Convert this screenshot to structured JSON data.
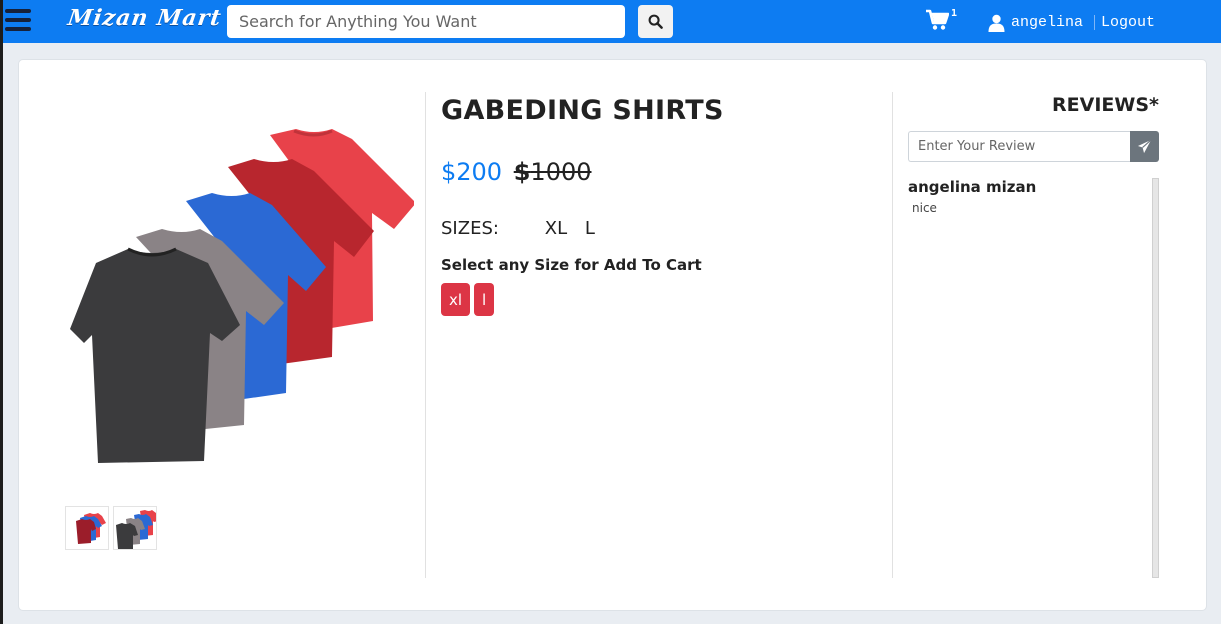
{
  "header": {
    "brand": "Mizan Mart",
    "search": {
      "placeholder": "Search for Anything You Want",
      "value": ""
    },
    "cart": {
      "icon": "shopping-cart-icon",
      "count": "1"
    },
    "user": {
      "icon": "user-icon",
      "name": "angelina"
    },
    "logout_label": "Logout"
  },
  "product": {
    "title": "GABEDING SHIRTS",
    "price": "$200",
    "old_price_symbol": "$",
    "old_price_amount": "1000",
    "sizes_label": "SIZES:",
    "sizes": [
      "XL",
      "L"
    ],
    "select_size_label": "Select any Size for Add To Cart",
    "size_buttons": [
      "xl",
      "l"
    ],
    "image_icon": "tshirts-stack-image",
    "thumbnails": [
      "tshirts-thumbnail-1",
      "tshirts-thumbnail-2"
    ]
  },
  "reviews": {
    "title": "REVIEWS*",
    "input_placeholder": "Enter Your Review",
    "send_icon": "paper-plane-icon",
    "items": [
      {
        "author": "angelina mizan",
        "text": "nice"
      }
    ]
  },
  "colors": {
    "navbar": "#0d7cf2",
    "price_new": "#0d7cf2",
    "size_button": "#dc3545",
    "send_button": "#6c757d"
  }
}
